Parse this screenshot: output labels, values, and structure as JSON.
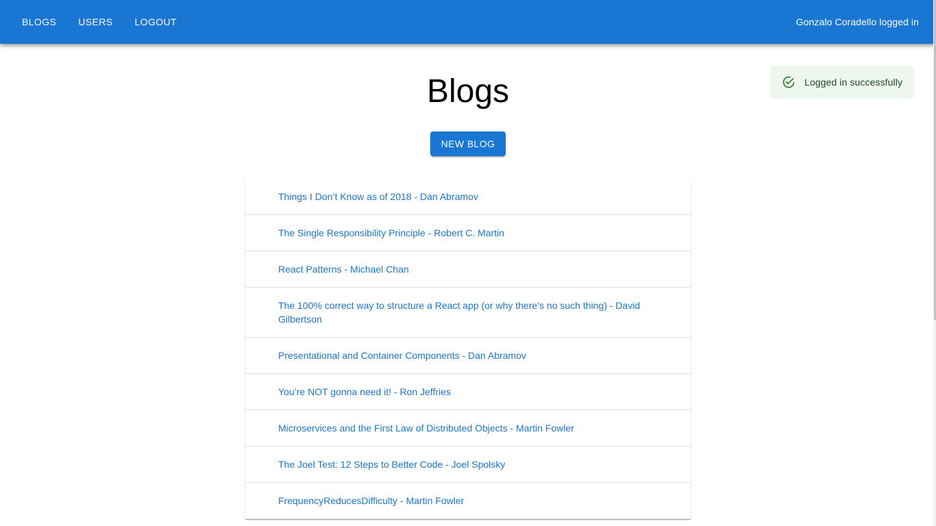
{
  "header": {
    "nav": [
      {
        "label": "BLOGS"
      },
      {
        "label": "USERS"
      },
      {
        "label": "LOGOUT"
      }
    ],
    "user_status": "Gonzalo Coradello logged in"
  },
  "main": {
    "title": "Blogs",
    "new_blog_label": "NEW BLOG"
  },
  "notification": {
    "icon": "check-circle-icon",
    "text": "Logged in successfully",
    "background": "#edf7ed",
    "text_color": "#1e4620"
  },
  "blogs": [
    {
      "text": "Things I Don’t Know as of 2018 - Dan Abramov"
    },
    {
      "text": "The Single Responsibility Principle - Robert C. Martin"
    },
    {
      "text": "React Patterns - Michael Chan"
    },
    {
      "text": "The 100% correct way to structure a React app (or why there’s no such thing) - David Gilbertson"
    },
    {
      "text": "Presentational and Container Components - Dan Abramov"
    },
    {
      "text": "You’re NOT gonna need it! - Ron Jeffries"
    },
    {
      "text": "Microservices and the First Law of Distributed Objects - Martin Fowler"
    },
    {
      "text": "The Joel Test: 12 Steps to Better Code - Joel Spolsky"
    },
    {
      "text": "FrequencyReducesDifficulty - Martin Fowler"
    }
  ],
  "colors": {
    "primary": "#1976d2",
    "link": "#1976d2",
    "divider": "#e0e0e0"
  }
}
